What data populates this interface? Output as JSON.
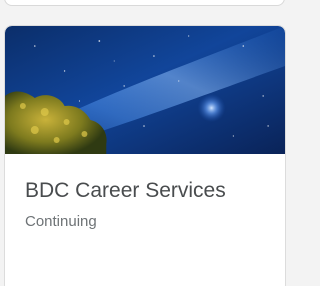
{
  "card": {
    "title": "BDC Career Services",
    "status": "Continuing",
    "image_alt": "Night sky with milky way above tree foliage"
  },
  "colors": {
    "title": "#494c4e",
    "status": "#6e7376",
    "border": "#dcdcdc"
  }
}
